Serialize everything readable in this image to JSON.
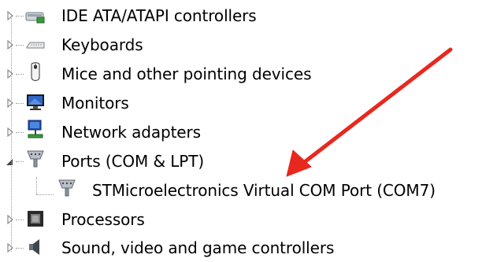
{
  "device_tree": {
    "items": [
      {
        "label": "IDE ATA/ATAPI controllers",
        "icon": "ide-controller-icon",
        "expanded": false
      },
      {
        "label": "Keyboards",
        "icon": "keyboard-icon",
        "expanded": false
      },
      {
        "label": "Mice and other pointing devices",
        "icon": "mouse-icon",
        "expanded": false
      },
      {
        "label": "Monitors",
        "icon": "monitor-icon",
        "expanded": false
      },
      {
        "label": "Network adapters",
        "icon": "network-adapter-icon",
        "expanded": false
      },
      {
        "label": "Ports (COM & LPT)",
        "icon": "port-connector-icon",
        "expanded": true,
        "children": [
          {
            "label": "STMicroelectronics Virtual COM Port (COM7)",
            "icon": "port-connector-icon"
          }
        ]
      },
      {
        "label": "Processors",
        "icon": "processor-chip-icon",
        "expanded": false
      },
      {
        "label": "Sound, video and game controllers",
        "icon": "speaker-icon",
        "expanded": false
      }
    ]
  },
  "annotation": {
    "arrow_color": "#e8281e"
  }
}
